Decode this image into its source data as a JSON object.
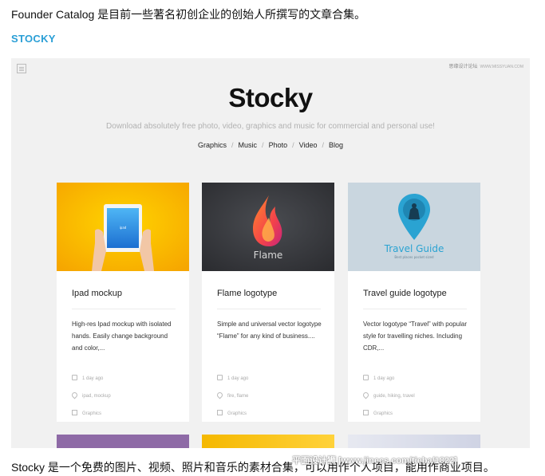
{
  "article": {
    "intro": "Founder Catalog 是目前一些著名初创企业的创始人所撰写的文章合集。",
    "section_title": "STOCKY",
    "outro": "Stocky 是一个免费的图片、视频、照片和音乐的素材合集，可以用作个人项目，能用作商业项目。",
    "watermark": "平面设计狮 [www.jinecs.com/tieba/1822]"
  },
  "screenshot": {
    "watermark_site": "思缘设计论坛",
    "watermark_url": "WWW.MISSYUAN.COM",
    "hero_title": "Stocky",
    "tagline": "Download absolutely free photo, video, graphics and music for commercial and personal use!",
    "nav": [
      "Graphics",
      "Music",
      "Photo",
      "Video",
      "Blog"
    ],
    "cards": [
      {
        "title": "Ipad mockup",
        "description": "High-res Ipad mockup with isolated hands. Easily change background and color,...",
        "date": "1 day ago",
        "tags": "ipad, mockup",
        "category": "Graphics",
        "image_label": "",
        "image_subtitle": ""
      },
      {
        "title": "Flame logotype",
        "description": "Simple and universal vector logotype “Flame” for any kind of business....",
        "date": "1 day ago",
        "tags": "fire, flame",
        "category": "Graphics",
        "image_label": "Flame",
        "image_subtitle": ""
      },
      {
        "title": "Travel guide logotype",
        "description": "Vector logotype “Travel” with popular style for travelling niches. Including CDR,...",
        "date": "1 day ago",
        "tags": "guide, hiking, travel",
        "category": "Graphics",
        "image_label": "Travel Guide",
        "image_subtitle": "Best places pocket sized"
      }
    ]
  },
  "colors": {
    "section_title": "#2a9fd6",
    "page_bg": "#f1f1f1",
    "ipad_bg": "#fbb800",
    "flame_bg": "#3a3c40",
    "travel_bg": "#c9d6df",
    "travel_accent": "#2aa3d2",
    "strip_left": "#8e6aa6",
    "strip_mid": "#f5b800",
    "strip_right": "#d7dbe8"
  }
}
